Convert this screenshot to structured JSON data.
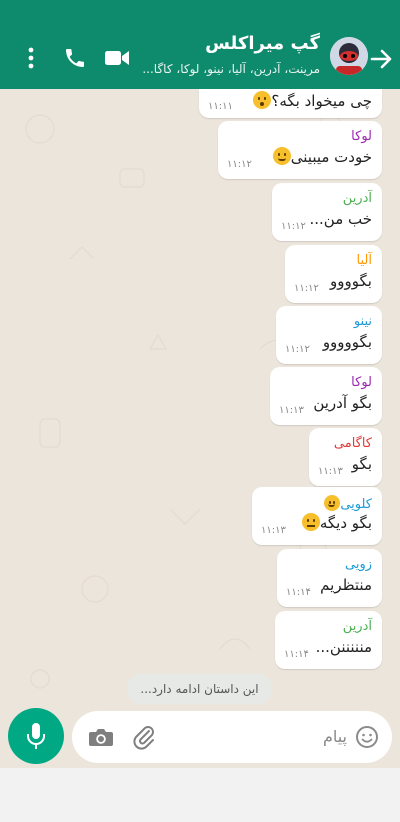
{
  "header": {
    "title": "گپ میراکلس",
    "subtitle": "مرینت، آدرین، آلیا، نینو، لوکا، کاگا...",
    "icons": [
      "back-arrow-icon",
      "avatar",
      "video-icon",
      "phone-icon",
      "more-vert-icon"
    ],
    "color": "#0e8a6d"
  },
  "messages": [
    {
      "sender": "",
      "text": "چی میخواد بگه؟",
      "emoji": "flushed",
      "time": "۱۱:۱۱"
    },
    {
      "sender": "لوکا",
      "sender_color": "#9b27b0",
      "text": "خودت میبینی",
      "emoji": "smile",
      "time": "۱۱:۱۲"
    },
    {
      "sender": "آدرین",
      "sender_color": "#4caf50",
      "text": "خب من...",
      "time": "۱۱:۱۲"
    },
    {
      "sender": "آلیا",
      "sender_color": "#ff9800",
      "text": "بگوووو",
      "time": "۱۱:۱۲"
    },
    {
      "sender": "نینو",
      "sender_color": "#1e9bd7",
      "text": "بگووووو",
      "time": "۱۱:۱۲"
    },
    {
      "sender": "لوکا",
      "sender_color": "#9b27b0",
      "text": "بگو آدرین",
      "time": "۱۱:۱۳"
    },
    {
      "sender": "کاگامی",
      "sender_color": "#e53935",
      "text": "بگو",
      "time": "۱۱:۱۳"
    },
    {
      "sender": "کلویی",
      "sender_color": "#1e9bd7",
      "sender_emoji": "smile",
      "text": "بگو دیگه",
      "emoji": "neutral",
      "time": "۱۱:۱۳"
    },
    {
      "sender": "زویی",
      "sender_color": "#1e9bd7",
      "text": "منتظریم",
      "time": "۱۱:۱۴"
    },
    {
      "sender": "آدرین",
      "sender_color": "#4caf50",
      "text": "منننننن...",
      "time": "۱۱:۱۴"
    }
  ],
  "notice": "این داستان ادامه دارد...",
  "composer": {
    "placeholder": "پیام",
    "icons": [
      "smile-icon",
      "paperclip-icon",
      "camera-icon",
      "mic-icon"
    ]
  }
}
